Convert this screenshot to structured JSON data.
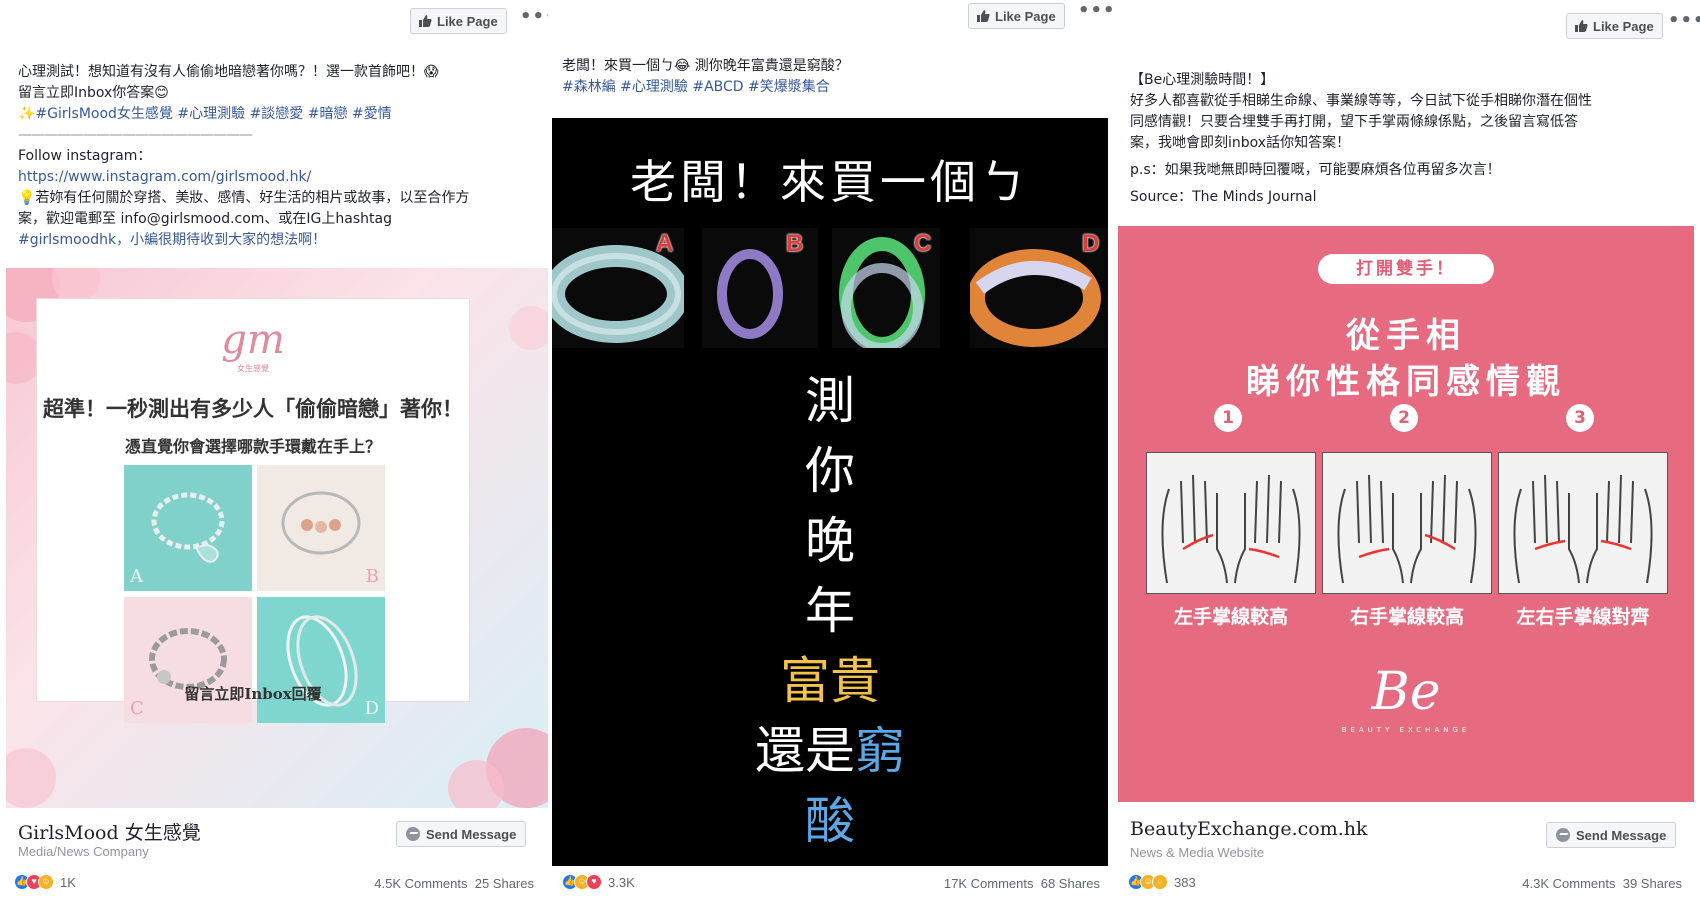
{
  "posts": [
    {
      "like_label": "Like Page",
      "lines": [
        "心理測試！想知道有沒有人偷偷地暗戀著你嗎？！選一款首飾吧！😱",
        "留言立即Inbox你答案😊",
        "✨#GirlsMood女生感覺 #心理測驗 #談戀愛 #暗戀 #愛情",
        "——————————————————",
        "Follow instagram：",
        "https://www.instagram.com/girlsmood.hk/",
        "💡若妳有任何關於穿搭、美妝、感情、好生活的相片或故事，以至合作方",
        "案，歡迎電郵至 info@girlsmood.com、或在IG上hashtag",
        "#girlsmoodhk，小編很期待收到大家的想法啊！"
      ],
      "image": {
        "logo": "gm",
        "logo_sub": "女生感覺",
        "title": "超準！一秒測出有多少人「偷偷暗戀」著你！",
        "subtitle": "憑直覺你會選擇哪款手環戴在手上？",
        "options": [
          "A",
          "B",
          "C",
          "D"
        ],
        "bottom": "留言立即Inbox回覆"
      },
      "page_name": "GirlsMood 女生感覺",
      "category": "Media/News Company",
      "send_label": "Send Message",
      "reactions_count": "1K",
      "comments": "4.5K Comments",
      "shares": "25 Shares"
    },
    {
      "like_label": "Like Page",
      "lines": [
        "老闆！來買一個ㄅ😂  測你晚年富貴還是窮酸？",
        "#森林編  #心理測驗  #ABCD  #笑爆漿集合"
      ],
      "image": {
        "headline": "老闆！來買一個ㄅ",
        "options": [
          "A",
          "B",
          "C",
          "D"
        ],
        "vertical_white": [
          "測",
          "你",
          "晚",
          "年"
        ],
        "rich": "富貴",
        "poor_prefix": "還是",
        "poor": "窮",
        "sour": "酸"
      },
      "page_name": "",
      "category": "",
      "reactions_count": "3.3K",
      "comments": "17K Comments",
      "shares": "68 Shares"
    },
    {
      "like_label": "Like Page",
      "lines": [
        "【Be心理測驗時間！】",
        "好多人都喜歡從手相睇生命線、事業線等等，今日試下從手相睇你潛在個性",
        "同感情觀！只要合埋雙手再打開，望下手掌兩條線係點，之後留言寫低答",
        "案，我哋會即刻inbox話你知答案！",
        "p.s：如果我哋無即時回覆嘅，可能要麻煩各位再留多次言！",
        "Source：The Minds Journal"
      ],
      "image": {
        "pill": "打開雙手！",
        "title1": "從手相",
        "title2": "睇你性格同感情觀",
        "numbers": [
          "1",
          "2",
          "3"
        ],
        "labels": [
          "左手掌線較高",
          "右手掌線較高",
          "左右手掌線對齊"
        ],
        "logo": "Be",
        "logo_sub": "BEAUTY EXCHANGE"
      },
      "page_name": "BeautyExchange.com.hk",
      "category": "News & Media Website",
      "send_label": "Send Message",
      "reactions_count": "383",
      "comments": "4.3K Comments",
      "shares": "39 Shares"
    }
  ],
  "colors": {
    "facebook_blue": "#385898",
    "pink_bg": "#e66a80",
    "black_bg": "#000000",
    "rich_gold": "#f2c24a",
    "poor_blue": "#5aa8e6"
  }
}
